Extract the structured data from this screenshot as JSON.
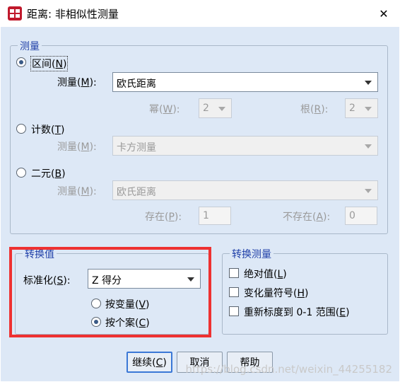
{
  "window": {
    "title": "距离: 非相似性测量",
    "close_glyph": "✕"
  },
  "measure_group": {
    "legend": "测量",
    "interval": {
      "radio_label": "区间",
      "mnemonic": "N",
      "measure_label": "测量",
      "measure_mnemonic": "M",
      "measure_value": "欧氏距离",
      "power_label": "幂",
      "power_mnemonic": "W",
      "power_value": "2",
      "root_label": "根",
      "root_mnemonic": "R",
      "root_value": "2"
    },
    "counts": {
      "radio_label": "计数",
      "mnemonic": "T",
      "measure_label": "测量",
      "measure_mnemonic": "M",
      "measure_value": "卡方测量"
    },
    "binary": {
      "radio_label": "二元",
      "mnemonic": "B",
      "measure_label": "测量",
      "measure_mnemonic": "M",
      "measure_value": "欧氏距离",
      "present_label": "存在",
      "present_mnemonic": "P",
      "present_value": "1",
      "absent_label": "不存在",
      "absent_mnemonic": "A",
      "absent_value": "0"
    }
  },
  "transform_values": {
    "legend": "转换值",
    "standardize_label": "标准化",
    "standardize_mnemonic": "S",
    "standardize_value": "Z 得分",
    "by_variable_label": "按变量",
    "by_variable_mnemonic": "V",
    "by_case_label": "按个案",
    "by_case_mnemonic": "C"
  },
  "transform_measures": {
    "legend": "转换测量",
    "absolute_label": "绝对值",
    "absolute_mnemonic": "L",
    "change_sign_label": "变化量符号",
    "change_sign_mnemonic": "H",
    "rescale_label": "重新标度到 0-1 范围",
    "rescale_mnemonic": "E"
  },
  "buttons": {
    "continue_label": "继续",
    "continue_mnemonic": "C",
    "cancel_label": "取消",
    "help_label": "帮助"
  },
  "watermark": "https://blog.csdn.net/weixin_44255182",
  "colors": {
    "client_bg": "#dde8f6",
    "legend_text": "#1f3fa8",
    "highlight_border": "#ee3131",
    "primary_button_border": "#3b78d6"
  }
}
